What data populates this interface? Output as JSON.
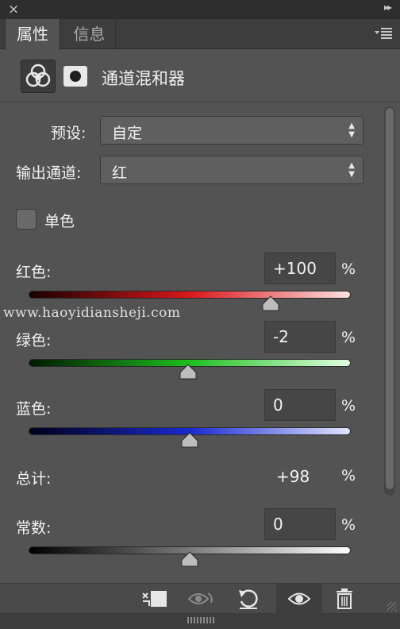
{
  "window": {
    "close_label": "×"
  },
  "tabs": [
    {
      "label": "属性",
      "active": true
    },
    {
      "label": "信息",
      "active": false
    }
  ],
  "header": {
    "title": "通道混和器",
    "icons": [
      "channel-mixer-icon",
      "mask-icon"
    ]
  },
  "preset": {
    "label": "预设:",
    "value": "自定"
  },
  "output_channel": {
    "label": "输出通道:",
    "value": "红"
  },
  "monochrome": {
    "label": "单色",
    "checked": false
  },
  "channels": [
    {
      "key": "red",
      "label": "红色:",
      "value": "+100",
      "unit": "%",
      "level": 100,
      "gradient": [
        "#1a0000",
        "#d9181c",
        "#ffe0e0"
      ]
    },
    {
      "key": "green",
      "label": "绿色:",
      "value": "-2",
      "unit": "%",
      "level": -2,
      "gradient": [
        "#001a00",
        "#1fbf1f",
        "#e2ffe2"
      ]
    },
    {
      "key": "blue",
      "label": "蓝色:",
      "value": "0",
      "unit": "%",
      "level": 0,
      "gradient": [
        "#00001a",
        "#1a2ad0",
        "#e2e6ff"
      ]
    }
  ],
  "total": {
    "label": "总计:",
    "value": "+98",
    "unit": "%"
  },
  "constant": {
    "label": "常数:",
    "value": "0",
    "unit": "%",
    "level": 0,
    "gradient": [
      "#000000",
      "#7a7a7a",
      "#ffffff"
    ]
  },
  "watermark": "www.haoyidiansheji.com",
  "bottom_icons": [
    "clip-to-layer-icon",
    "view-previous-icon",
    "reset-icon",
    "visibility-eye-icon",
    "trash-icon"
  ]
}
